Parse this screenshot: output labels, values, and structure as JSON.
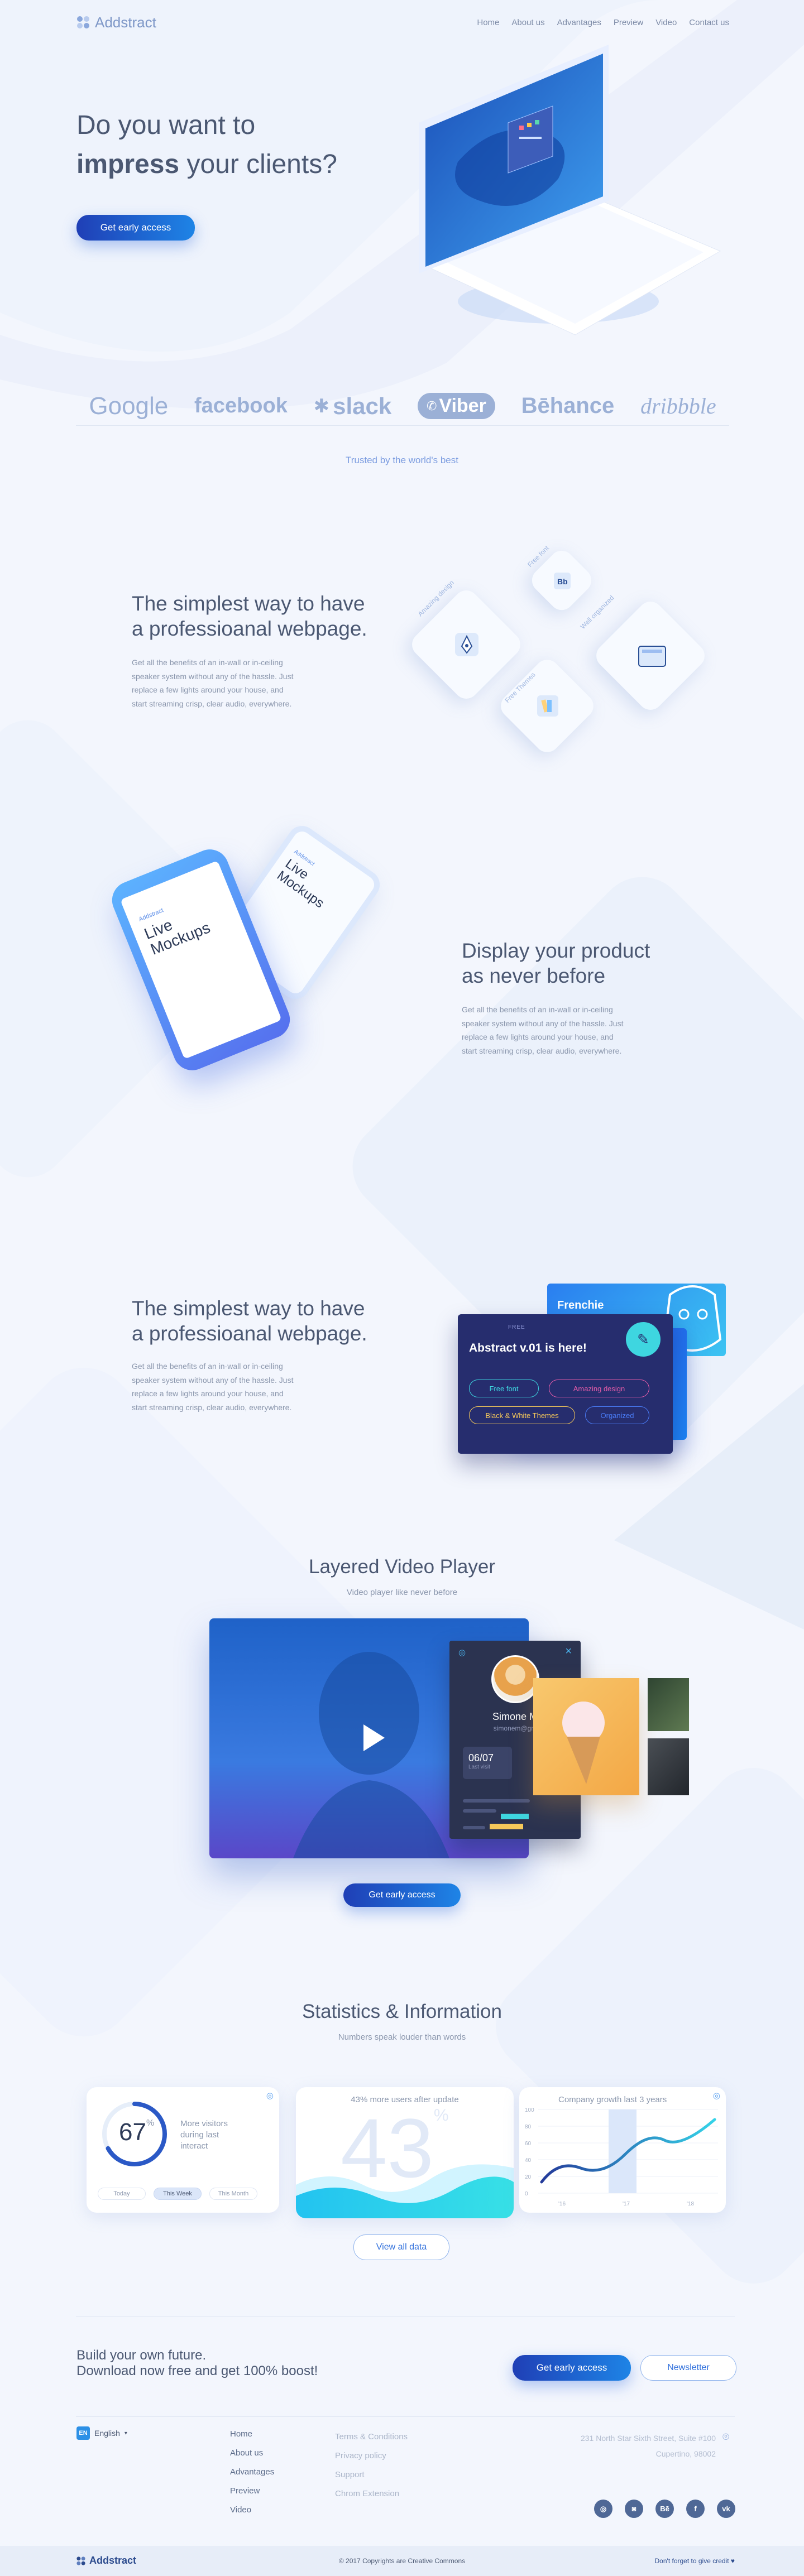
{
  "brand": {
    "name": "Addstract"
  },
  "nav": {
    "items": [
      "Home",
      "About us",
      "Advantages",
      "Preview",
      "Video",
      "Contact us"
    ]
  },
  "hero": {
    "line1": "Do you want to",
    "bold": "impress",
    "rest": " your clients?",
    "cta": "Get early access"
  },
  "logos": {
    "items": [
      "Google",
      "facebook",
      "slack",
      "Viber",
      "Bēhance",
      "dribbble"
    ],
    "tagline": "Trusted by the world's best"
  },
  "feature1": {
    "title_line1": "The simplest way to have",
    "title_line2": "a professioanal webpage.",
    "body": "Get all the benefits of an in-wall or in-ceiling speaker system without any of the hassle. Just replace a few lights around your house, and start streaming crisp, clear audio, everywhere.",
    "tiles": [
      "Amazing design",
      "Free font",
      "Well organized",
      "Free Themes"
    ]
  },
  "feature2": {
    "title_line1": "Display your product",
    "title_line2": "as never before",
    "body": "Get all the benefits of an in-wall or in-ceiling speaker system without any of the hassle. Just replace a few lights around your house, and start streaming crisp, clear audio, everywhere.",
    "phone_brand": "Addstract",
    "phone_title": "Live Mockups"
  },
  "feature3": {
    "title_line1": "The simplest way to have",
    "title_line2": "a professioanal webpage.",
    "body": "Get all the benefits of an in-wall or in-ceiling speaker system without any of the hassle. Just replace a few lights around your house, and start streaming crisp, clear audio, everywhere.",
    "card_small": "FREE",
    "card_title": "Abstract v.01 is here!",
    "back_card": "Frenchie",
    "tags": [
      "Free font",
      "Amazing design",
      "Black & White Themes",
      "Organized"
    ]
  },
  "video": {
    "title": "Layered Video Player",
    "subtitle": "Video player like never before",
    "profile_name": "Simone M",
    "profile_email": "simonem@gm",
    "date_value": "06/07",
    "date_label": "Last visit",
    "cta": "Get early access"
  },
  "stats": {
    "title": "Statistics & Information",
    "subtitle": "Numbers speak louder than words",
    "gauge_value": "67",
    "gauge_unit": "%",
    "gauge_percent": 67,
    "gauge_label": "More visitors during last interact",
    "ranges": [
      "Today",
      "This Week",
      "This Month"
    ],
    "mid_title": "43% more users after update",
    "mid_value": "43",
    "mid_unit": "%",
    "chart_title": "Company growth last 3 years",
    "chart_y_ticks": [
      "100",
      "80",
      "60",
      "40",
      "20",
      "0"
    ],
    "chart_x_ticks": [
      "'16",
      "'17",
      "'18"
    ],
    "view_all": "View all data"
  },
  "cta_band": {
    "line1": "Build your own future.",
    "line2": "Download now free and get 100% boost!",
    "primary": "Get early access",
    "secondary": "Newsletter"
  },
  "footer": {
    "lang_badge": "EN",
    "language": "English",
    "links1": [
      "Home",
      "About us",
      "Advantages",
      "Preview",
      "Video"
    ],
    "links2": [
      "Terms & Conditions",
      "Privacy policy",
      "Support",
      "Chrom Extension"
    ],
    "address_line1": "231 North Star  Sixth Street, Suite #100",
    "address_line2": "Cupertino, 98002",
    "socials": [
      "dribbble",
      "instagram",
      "behance",
      "facebook",
      "vk"
    ],
    "copyright": "© 2017  Copyrights are Creative Commons",
    "credit": "Don't forget to give credit ♥"
  },
  "colors": {
    "accent": "#1e6fe0",
    "text": "#4b5872",
    "muted": "#8b97ad",
    "bg": "#f3f6fd"
  }
}
